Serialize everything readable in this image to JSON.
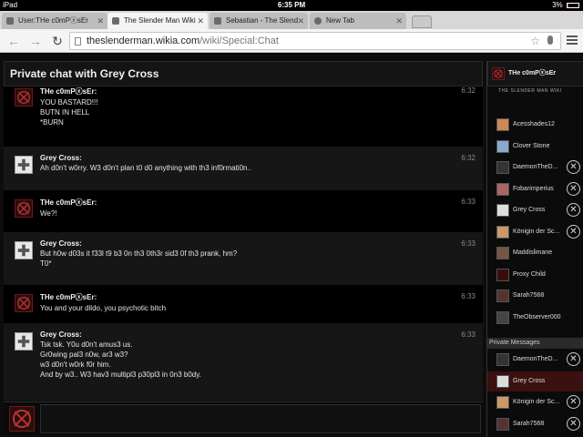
{
  "status": {
    "device": "iPad",
    "time": "6:35 PM",
    "battery": "3%"
  },
  "tabs": [
    {
      "label": "User:THe c0mPⓧsEr"
    },
    {
      "label": "The Slender Man Wiki"
    },
    {
      "label": "Sebastian - The Slend"
    },
    {
      "label": "New Tab"
    }
  ],
  "url": {
    "host": "theslenderman.wikia.com",
    "path": "/wiki/Special:Chat"
  },
  "chat": {
    "title": "Private chat with Grey Cross",
    "messages": [
      {
        "author": "THe c0mPⓧsEr:",
        "time": "6:32",
        "avatar": "x",
        "lines": [
          "YOU BASTARD!!!",
          "BUTN IN HELL",
          "*BURN"
        ]
      },
      {
        "author": "Grey Cross:",
        "time": "6:32",
        "avatar": "g",
        "lines": [
          "Ah d0n't w0rry. W3 d0n't plan t0 d0 anything with th3 inf0rmati0n.."
        ]
      },
      {
        "author": "THe c0mPⓧsEr:",
        "time": "6:33",
        "avatar": "x",
        "lines": [
          "We?!"
        ]
      },
      {
        "author": "Grey Cross:",
        "time": "6:33",
        "avatar": "g",
        "lines": [
          "But h0w d03s it f33l t9 b3 0n th3 0th3r sid3 0f th3 prank, hm?",
          "T0*"
        ]
      },
      {
        "author": "THe c0mPⓧsEr:",
        "time": "6:33",
        "avatar": "x",
        "lines": [
          "You and your dildo, you psychotic bitch"
        ]
      },
      {
        "author": "Grey Cross:",
        "time": "6:33",
        "avatar": "g",
        "lines": [
          "Tsk tsk. Y0u d0n't amus3 us.",
          "Gr0wing pal3 n0w, ar3 w3?",
          "w3 d0n't w0rk f0r him.",
          "And by w3.. W3 hav3 multipl3 p30pl3 in 0n3 b0dy."
        ]
      }
    ]
  },
  "sidebar": {
    "self_name": "THe c0mPⓧsEr",
    "wiki_logo": "THE SLENDER MAN WIKI",
    "users": [
      {
        "name": "Acesshades12",
        "close": false
      },
      {
        "name": "Clover Stone",
        "close": false
      },
      {
        "name": "DaemonTheD...",
        "close": true
      },
      {
        "name": "Fobarimperius",
        "close": true
      },
      {
        "name": "Grey Cross",
        "close": true
      },
      {
        "name": "Königin der Sc...",
        "close": true
      },
      {
        "name": "Maddislimane",
        "close": false
      },
      {
        "name": "Proxy Child",
        "close": false
      },
      {
        "name": "Sarah7568",
        "close": false
      },
      {
        "name": "TheObserver000",
        "close": false
      }
    ],
    "pm_header": "Private Messages",
    "pm_users": [
      {
        "name": "DaemonTheD...",
        "close": true
      },
      {
        "name": "Grey Cross",
        "close": false,
        "selected": true
      },
      {
        "name": "Königin der Sc...",
        "close": true
      },
      {
        "name": "Sarah7568",
        "close": true
      }
    ]
  }
}
